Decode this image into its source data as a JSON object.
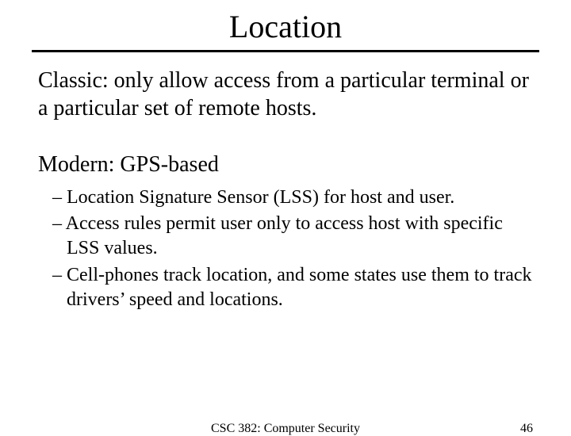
{
  "title": "Location",
  "paragraph_classic": "Classic: only allow access from a particular terminal or a particular set of remote hosts.",
  "subhead_modern": "Modern: GPS-based",
  "bullets": [
    "– Location Signature Sensor (LSS) for host and user.",
    "– Access rules permit user only to access host with specific LSS values.",
    "– Cell-phones track location, and some states use them to track drivers’ speed and locations."
  ],
  "footer": {
    "course": "CSC 382: Computer Security",
    "page": "46"
  }
}
